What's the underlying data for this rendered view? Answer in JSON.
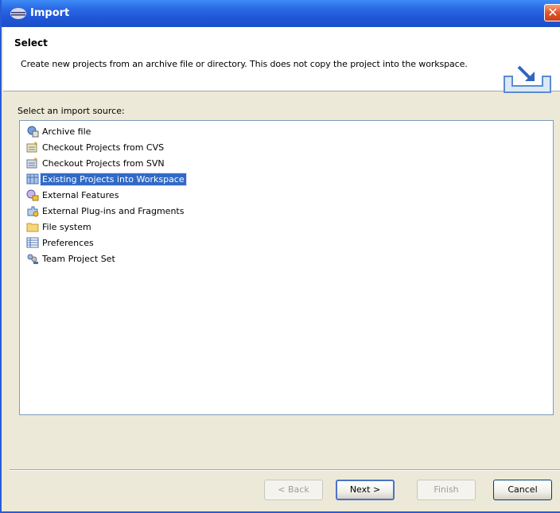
{
  "window": {
    "title": "Import",
    "close_glyph": "✕"
  },
  "header": {
    "title": "Select",
    "description": "Create new projects from an archive file or directory. This does not copy the project into the workspace.",
    "icon": "import-wizard-banner-icon"
  },
  "source_label": "Select an import source:",
  "sources": [
    {
      "label": "Archive file",
      "icon": "archive-file-icon"
    },
    {
      "label": "Checkout Projects from CVS",
      "icon": "cvs-checkout-icon"
    },
    {
      "label": "Checkout Projects from SVN",
      "icon": "svn-checkout-icon"
    },
    {
      "label": "Existing Projects into Workspace",
      "icon": "existing-projects-icon",
      "selected": true
    },
    {
      "label": "External Features",
      "icon": "external-features-icon"
    },
    {
      "label": "External Plug-ins and Fragments",
      "icon": "external-plugins-icon"
    },
    {
      "label": "File system",
      "icon": "folder-icon"
    },
    {
      "label": "Preferences",
      "icon": "preferences-icon"
    },
    {
      "label": "Team Project Set",
      "icon": "team-project-set-icon"
    }
  ],
  "buttons": {
    "back": "< Back",
    "next": "Next >",
    "finish": "Finish",
    "cancel": "Cancel"
  },
  "colors": {
    "selection": "#316ac5",
    "titlebar": "#2a66e3"
  }
}
